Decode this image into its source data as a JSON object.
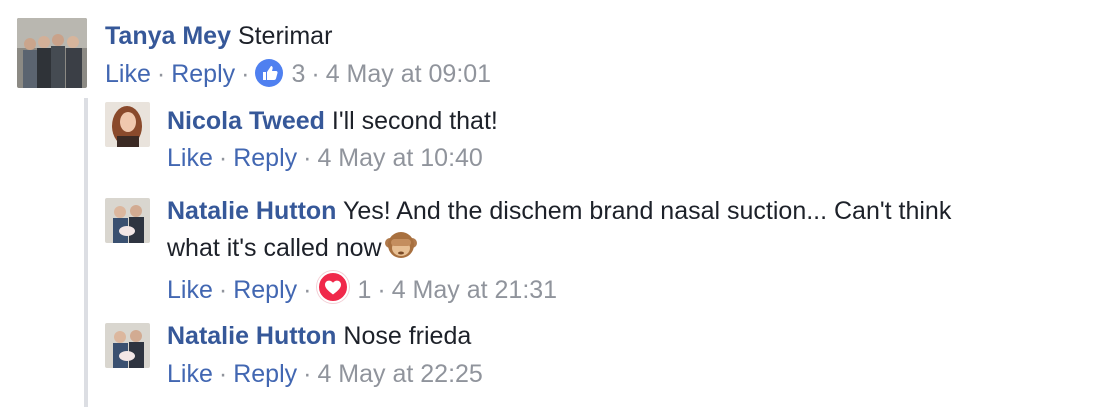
{
  "comments": [
    {
      "author": "Tanya Mey",
      "text": "Sterimar",
      "actions": {
        "like": "Like",
        "reply": "Reply",
        "reaction_icon": "like-icon",
        "reaction_count": "3",
        "timestamp": "4 May at 09:01"
      }
    },
    {
      "author": "Nicola Tweed",
      "text": "I'll second that!",
      "actions": {
        "like": "Like",
        "reply": "Reply",
        "timestamp": "4 May at 10:40"
      }
    },
    {
      "author": "Natalie Hutton",
      "text": "Yes! And the dischem brand nasal suction... Can't think",
      "text_line2": "what it's called now",
      "emoji": "see-no-evil-monkey-emoji",
      "actions": {
        "like": "Like",
        "reply": "Reply",
        "reaction_icon": "heart-icon",
        "reaction_count": "1",
        "timestamp": "4 May at 21:31"
      }
    },
    {
      "author": "Natalie Hutton",
      "text": "Nose frieda",
      "actions": {
        "like": "Like",
        "reply": "Reply",
        "timestamp": "4 May at 22:25"
      }
    }
  ],
  "colors": {
    "author": "#365899",
    "link": "#4267b2",
    "meta": "#90949c",
    "like_reaction": "#4f80f0",
    "love_reaction": "#f0284a",
    "thread_line": "#dcdee3"
  },
  "separator": "·"
}
